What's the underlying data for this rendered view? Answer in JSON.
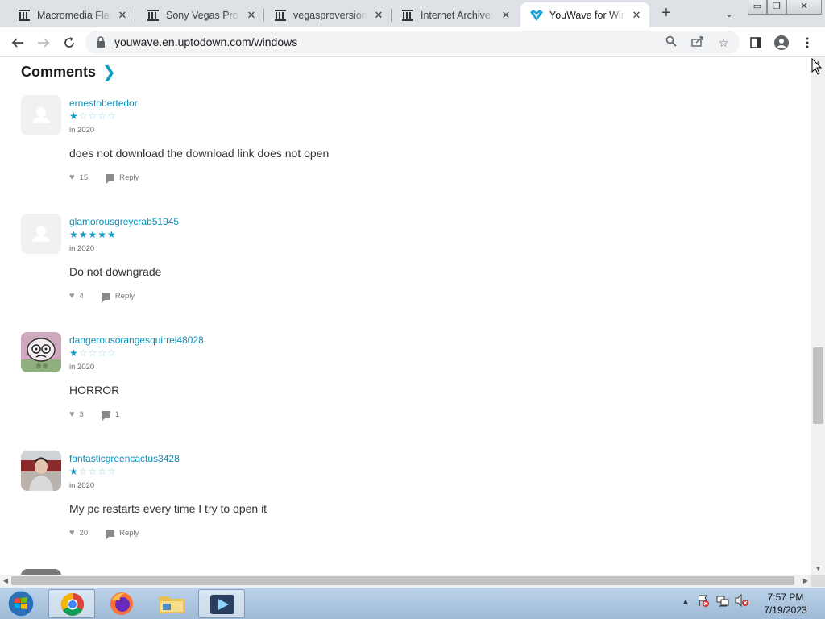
{
  "browser": {
    "tabs": [
      {
        "title": "Macromedia Flash",
        "favicon": "archive-icon",
        "active": false
      },
      {
        "title": "Sony Vegas Pro V",
        "favicon": "archive-icon",
        "active": false
      },
      {
        "title": "vegasproversions",
        "favicon": "archive-icon",
        "active": false
      },
      {
        "title": "Internet Archive:",
        "favicon": "archive-icon",
        "active": false
      },
      {
        "title": "YouWave for Wind",
        "favicon": "uptodown-icon",
        "active": true
      }
    ],
    "url": "youwave.en.uptodown.com/windows"
  },
  "page": {
    "section_title": "Comments",
    "comments": [
      {
        "user": "ernestobertedor",
        "rating": 1,
        "date": "in 2020",
        "text": "does not download the download link does not open",
        "likes": "15",
        "reply": "Reply",
        "avatar": "default"
      },
      {
        "user": "glamorousgreycrab51945",
        "rating": 5,
        "date": "in 2020",
        "text": "Do not downgrade",
        "likes": "4",
        "reply": "Reply",
        "avatar": "default"
      },
      {
        "user": "dangerousorangesquirrel48028",
        "rating": 1,
        "date": "in 2020",
        "text": "HORROR",
        "likes": "3",
        "reply": "1",
        "avatar": "cartoon"
      },
      {
        "user": "fantasticgreencactus3428",
        "rating": 1,
        "date": "in 2020",
        "text": "My pc restarts every time I try to open it",
        "likes": "20",
        "reply": "Reply",
        "avatar": "photo"
      }
    ]
  },
  "taskbar": {
    "time": "7:57 PM",
    "date": "7/19/2023"
  },
  "colors": {
    "accent": "#0d9cc4",
    "username": "#0a8fb9"
  }
}
